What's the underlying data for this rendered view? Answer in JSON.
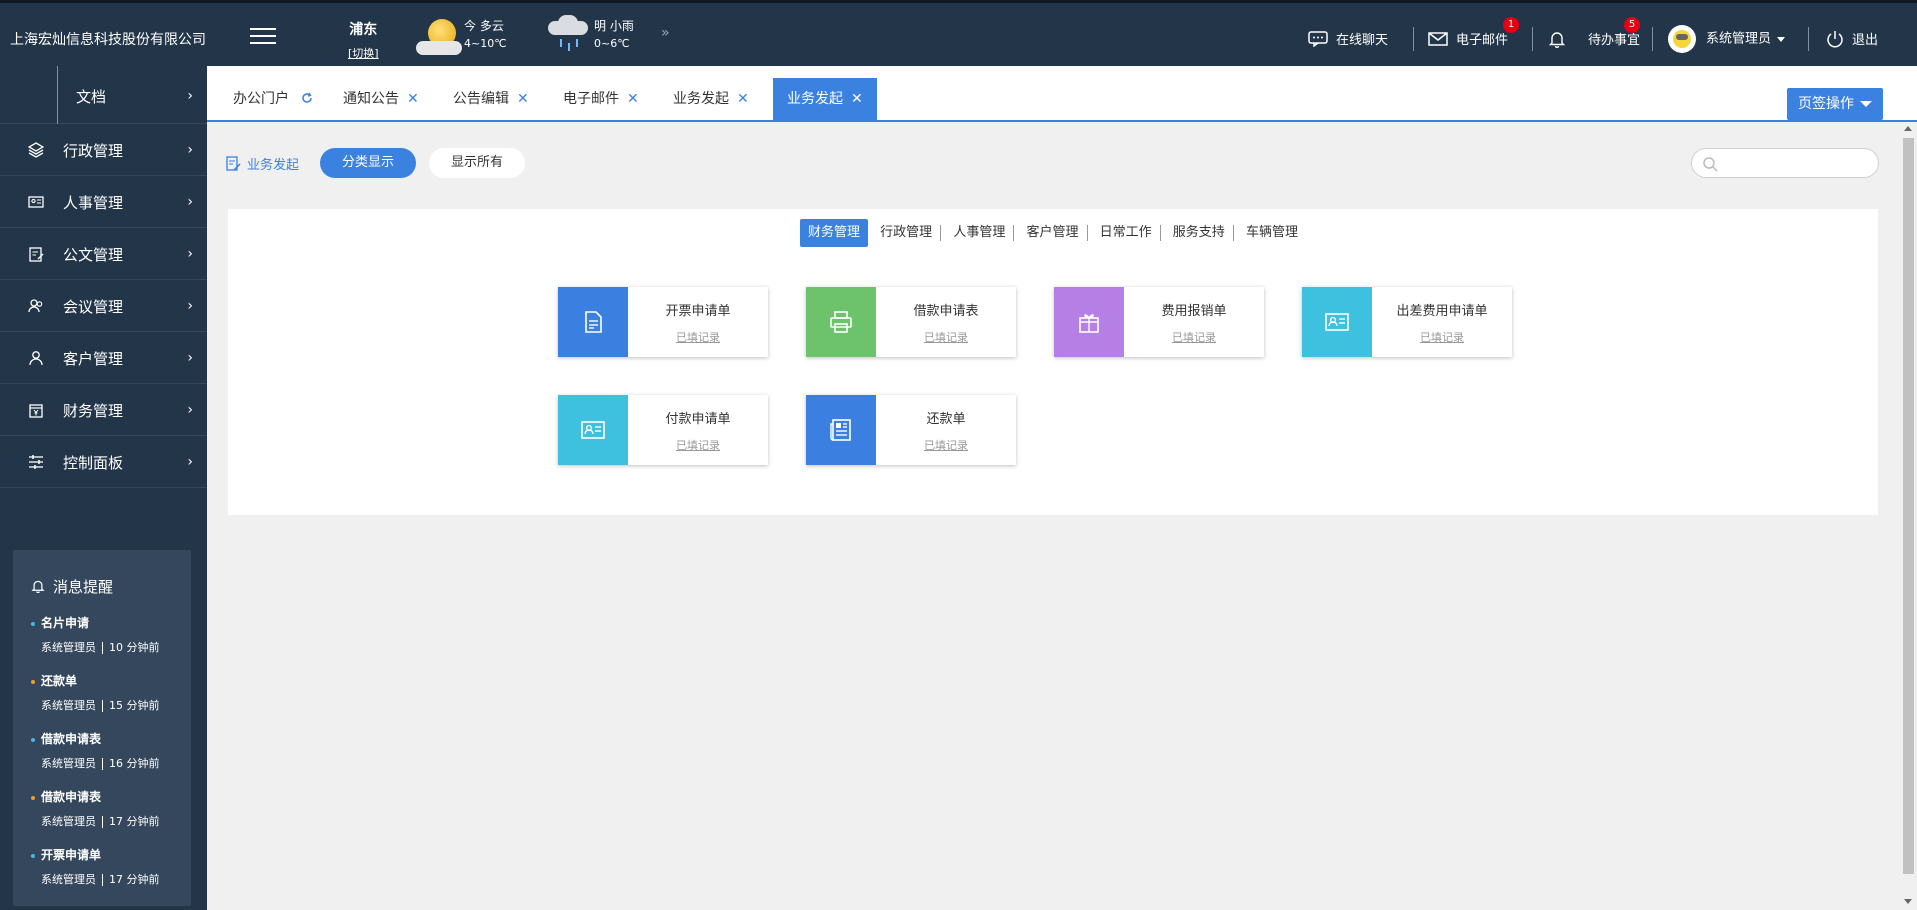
{
  "header": {
    "company": "上海宏灿信息科技股份有限公司",
    "location": {
      "city": "浦东",
      "switch_label": "[切换]"
    },
    "weather_today": {
      "label": "今 多云",
      "temp": "4~10℃",
      "icon": "sun-cloud-icon"
    },
    "weather_tomorrow": {
      "label": "明 小雨",
      "temp": "0~6℃",
      "icon": "cloud-rain-icon"
    },
    "more_glyph": "»",
    "chat_label": "在线聊天",
    "mail_label": "电子邮件",
    "mail_badge": "1",
    "todo_label": "待办事宜",
    "todo_badge": "5",
    "user_label": "系统管理员",
    "logout_label": "退出"
  },
  "sidebar": {
    "top_item": {
      "label": "文档",
      "arrow": "›"
    },
    "items": [
      {
        "label": "行政管理",
        "icon": "layers-icon",
        "arrow": "›"
      },
      {
        "label": "人事管理",
        "icon": "id-card-icon",
        "arrow": "›"
      },
      {
        "label": "公文管理",
        "icon": "document-edit-icon",
        "arrow": "›"
      },
      {
        "label": "会议管理",
        "icon": "meeting-icon",
        "arrow": "›"
      },
      {
        "label": "客户管理",
        "icon": "user-icon",
        "arrow": "›"
      },
      {
        "label": "财务管理",
        "icon": "finance-icon",
        "arrow": "›"
      },
      {
        "label": "控制面板",
        "icon": "sliders-icon",
        "arrow": "›"
      }
    ],
    "messages": {
      "title": "消息提醒",
      "items": [
        {
          "title": "名片申请",
          "user": "系统管理员",
          "time": "10 分钟前",
          "dot_color": "#41b9e8"
        },
        {
          "title": "还款单",
          "user": "系统管理员",
          "time": "15 分钟前",
          "dot_color": "#f0a020"
        },
        {
          "title": "借款申请表",
          "user": "系统管理员",
          "time": "16 分钟前",
          "dot_color": "#41b9e8"
        },
        {
          "title": "借款申请表",
          "user": "系统管理员",
          "time": "17 分钟前",
          "dot_color": "#f0a020"
        },
        {
          "title": "开票申请单",
          "user": "系统管理员",
          "time": "17 分钟前",
          "dot_color": "#41b9e8"
        }
      ]
    }
  },
  "tabs": [
    {
      "label": "办公门户",
      "icon": "refresh-icon"
    },
    {
      "label": "通知公告",
      "close": "✕"
    },
    {
      "label": "公告编辑",
      "close": "✕"
    },
    {
      "label": "电子邮件",
      "close": "✕"
    },
    {
      "label": "业务发起",
      "close": "✕"
    },
    {
      "label": "业务发起",
      "close": "✕",
      "active": true
    }
  ],
  "page_ops_label": "页签操作",
  "toolbar": {
    "crumb": "业务发起",
    "category_view": "分类显示",
    "show_all": "显示所有",
    "search_placeholder": ""
  },
  "categories": [
    "财务管理",
    "行政管理",
    "人事管理",
    "客户管理",
    "日常工作",
    "服务支持",
    "车辆管理"
  ],
  "active_category": "财务管理",
  "cards": [
    {
      "name": "开票申请单",
      "record": "已填记录",
      "color": "#3b7fe0",
      "icon": "document-icon"
    },
    {
      "name": "借款申请表",
      "record": "已填记录",
      "color": "#6cc36b",
      "icon": "printer-icon"
    },
    {
      "name": "费用报销单",
      "record": "已填记录",
      "color": "#b57fe6",
      "icon": "gift-icon"
    },
    {
      "name": "出差费用申请单",
      "record": "已填记录",
      "color": "#3ec1de",
      "icon": "id-card-icon"
    },
    {
      "name": "付款申请单",
      "record": "已填记录",
      "color": "#3ec1de",
      "icon": "id-card-icon"
    },
    {
      "name": "还款单",
      "record": "已填记录",
      "color": "#3b7fe0",
      "icon": "newspaper-icon"
    }
  ]
}
